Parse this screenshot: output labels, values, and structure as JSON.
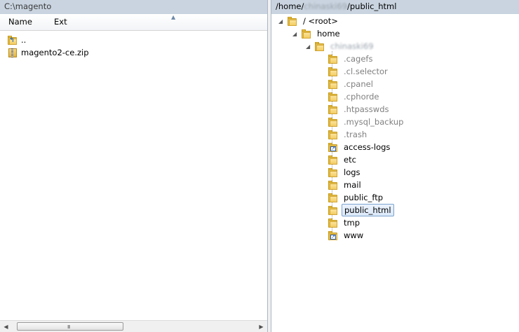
{
  "left_pane": {
    "path": "C:\\magento",
    "columns": {
      "name": "Name",
      "ext": "Ext",
      "sort_indicator": "▲"
    },
    "items": [
      {
        "label": "..",
        "icon": "up-folder-icon"
      },
      {
        "label": "magento2-ce.zip",
        "icon": "zip-file-icon"
      }
    ],
    "scrollbar": {
      "left_arrow": "◀",
      "right_arrow": "▶",
      "grip": "III"
    }
  },
  "right_pane": {
    "path_prefix": "/home/",
    "path_user": "chinaski69",
    "path_suffix": "/public_html",
    "tree": {
      "root": {
        "label": "/ <root>",
        "expander": "◢"
      },
      "home": {
        "label": "home",
        "expander": "◢"
      },
      "user": {
        "label": "chinaski69",
        "expander": "◢"
      },
      "children": [
        {
          "label": ".cagefs",
          "hidden": true
        },
        {
          "label": ".cl.selector",
          "hidden": true
        },
        {
          "label": ".cpanel",
          "hidden": true
        },
        {
          "label": ".cphorde",
          "hidden": true
        },
        {
          "label": ".htpasswds",
          "hidden": true
        },
        {
          "label": ".mysql_backup",
          "hidden": true
        },
        {
          "label": ".trash",
          "hidden": true
        },
        {
          "label": "access-logs",
          "hidden": false,
          "link": true
        },
        {
          "label": "etc",
          "hidden": false
        },
        {
          "label": "logs",
          "hidden": false
        },
        {
          "label": "mail",
          "hidden": false
        },
        {
          "label": "public_ftp",
          "hidden": false
        },
        {
          "label": "public_html",
          "hidden": false,
          "selected": true
        },
        {
          "label": "tmp",
          "hidden": false
        },
        {
          "label": "www",
          "hidden": false,
          "link": true
        }
      ]
    }
  },
  "colors": {
    "path_bar": "#c9d4e0",
    "folder": "#e8c34f",
    "hidden_text": "#808080",
    "selection_border": "#7da2ce"
  }
}
